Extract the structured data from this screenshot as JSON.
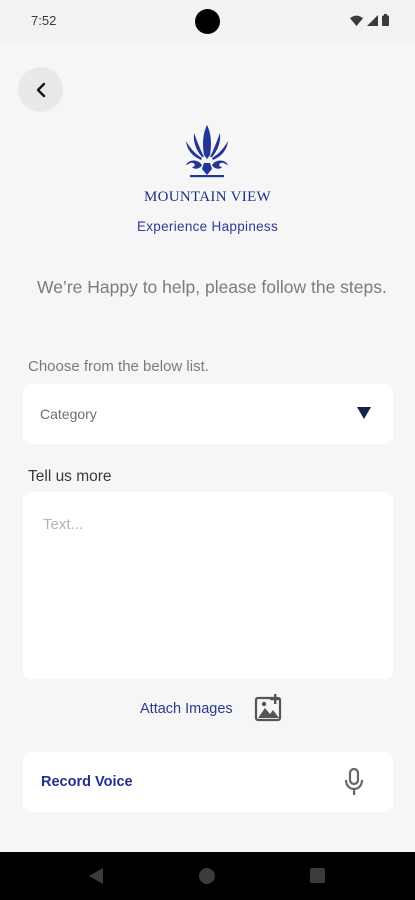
{
  "status_bar": {
    "time": "7:52"
  },
  "brand": {
    "name": "MOUNTAIN VIEW",
    "tagline": "Experience Happiness"
  },
  "intro": "We’re Happy to help, please follow the steps.",
  "category": {
    "label": "Choose from the below list.",
    "placeholder": "Category"
  },
  "details": {
    "label": "Tell us more",
    "placeholder": "Text..."
  },
  "attach": {
    "label": "Attach Images"
  },
  "record": {
    "label": "Record Voice"
  },
  "colors": {
    "brand": "#1f2f8f",
    "background": "#f6f6f6",
    "card": "#ffffff"
  },
  "icons": [
    "back-arrow-icon",
    "add-image-icon",
    "microphone-icon",
    "dropdown-caret-icon"
  ]
}
